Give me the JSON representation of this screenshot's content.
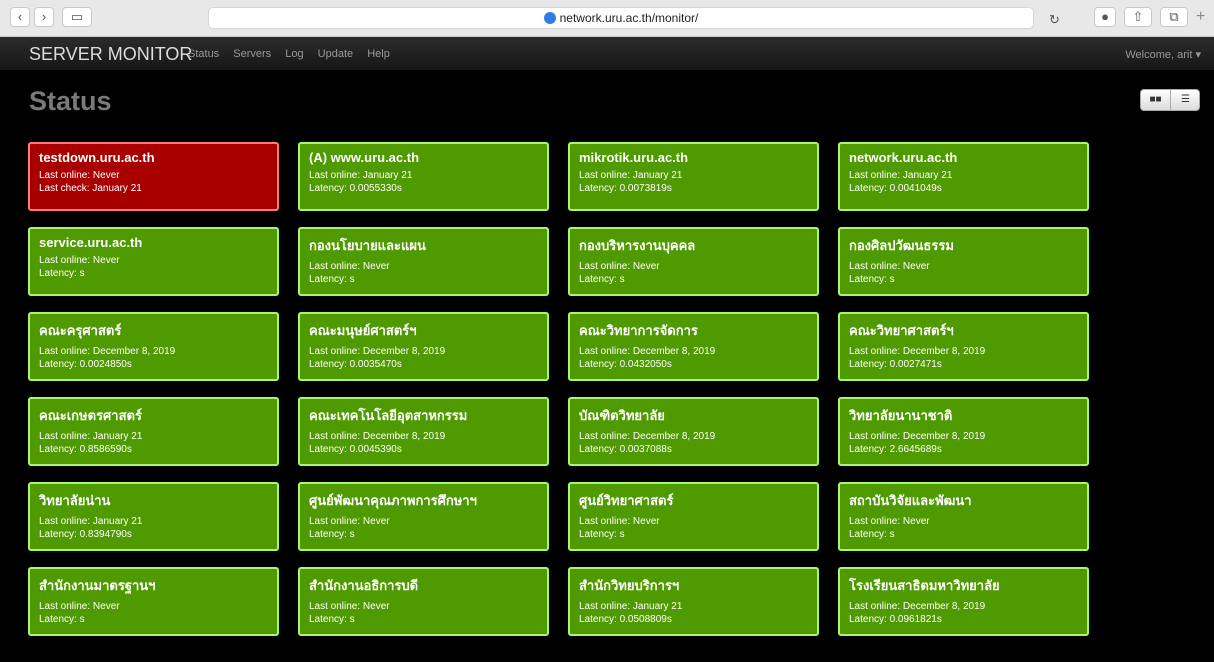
{
  "browser": {
    "url": "network.uru.ac.th/monitor/"
  },
  "navbar": {
    "brand": "SERVER MONITOR",
    "links": [
      "Status",
      "Servers",
      "Log",
      "Update",
      "Help"
    ],
    "welcome": "Welcome, arit ▾"
  },
  "page": {
    "title": "Status"
  },
  "servers": [
    {
      "name": "testdown.uru.ac.th",
      "line1": "Last online: Never",
      "line2": "Last check: January 21",
      "status": "down"
    },
    {
      "name": "(A) www.uru.ac.th",
      "line1": "Last online: January 21",
      "line2": "Latency: 0.0055330s",
      "status": "up"
    },
    {
      "name": "mikrotik.uru.ac.th",
      "line1": "Last online: January 21",
      "line2": "Latency: 0.0073819s",
      "status": "up"
    },
    {
      "name": "network.uru.ac.th",
      "line1": "Last online: January 21",
      "line2": "Latency: 0.0041049s",
      "status": "up"
    },
    {
      "name": "service.uru.ac.th",
      "line1": "Last online: Never",
      "line2": "Latency: s",
      "status": "up"
    },
    {
      "name": "กองนโยบายและแผน",
      "line1": "Last online: Never",
      "line2": "Latency: s",
      "status": "up"
    },
    {
      "name": "กองบริหารงานบุคคล",
      "line1": "Last online: Never",
      "line2": "Latency: s",
      "status": "up"
    },
    {
      "name": "กองศิลปวัฒนธรรม",
      "line1": "Last online: Never",
      "line2": "Latency: s",
      "status": "up"
    },
    {
      "name": "คณะครุศาสตร์",
      "line1": "Last online: December 8, 2019",
      "line2": "Latency: 0.0024850s",
      "status": "up"
    },
    {
      "name": "คณะมนุษย์ศาสตร์ฯ",
      "line1": "Last online: December 8, 2019",
      "line2": "Latency: 0.0035470s",
      "status": "up"
    },
    {
      "name": "คณะวิทยาการจัดการ",
      "line1": "Last online: December 8, 2019",
      "line2": "Latency: 0.0432050s",
      "status": "up"
    },
    {
      "name": "คณะวิทยาศาสตร์ฯ",
      "line1": "Last online: December 8, 2019",
      "line2": "Latency: 0.0027471s",
      "status": "up"
    },
    {
      "name": "คณะเกษตรศาสตร์",
      "line1": "Last online: January 21",
      "line2": "Latency: 0.8586590s",
      "status": "up"
    },
    {
      "name": "คณะเทคโนโลยีอุตสาหกรรม",
      "line1": "Last online: December 8, 2019",
      "line2": "Latency: 0.0045390s",
      "status": "up"
    },
    {
      "name": "บัณฑิตวิทยาลัย",
      "line1": "Last online: December 8, 2019",
      "line2": "Latency: 0.0037088s",
      "status": "up"
    },
    {
      "name": "วิทยาลัยนานาชาติ",
      "line1": "Last online: December 8, 2019",
      "line2": "Latency: 2.6645689s",
      "status": "up"
    },
    {
      "name": "วิทยาลัยน่าน",
      "line1": "Last online: January 21",
      "line2": "Latency: 0.8394790s",
      "status": "up"
    },
    {
      "name": "ศูนย์พัฒนาคุณภาพการศึกษาฯ",
      "line1": "Last online: Never",
      "line2": "Latency: s",
      "status": "up"
    },
    {
      "name": "ศูนย์วิทยาศาสตร์",
      "line1": "Last online: Never",
      "line2": "Latency: s",
      "status": "up"
    },
    {
      "name": "สถาบันวิจัยและพัฒนา",
      "line1": "Last online: Never",
      "line2": "Latency: s",
      "status": "up"
    },
    {
      "name": "สำนักงานมาตรฐานฯ",
      "line1": "Last online: Never",
      "line2": "Latency: s",
      "status": "up"
    },
    {
      "name": "สำนักงานอธิการบดี",
      "line1": "Last online: Never",
      "line2": "Latency: s",
      "status": "up"
    },
    {
      "name": "สำนักวิทยบริการฯ",
      "line1": "Last online: January 21",
      "line2": "Latency: 0.0508809s",
      "status": "up"
    },
    {
      "name": "โรงเรียนสาธิตมหาวิทยาลัย",
      "line1": "Last online: December 8, 2019",
      "line2": "Latency: 0.0961821s",
      "status": "up"
    }
  ]
}
